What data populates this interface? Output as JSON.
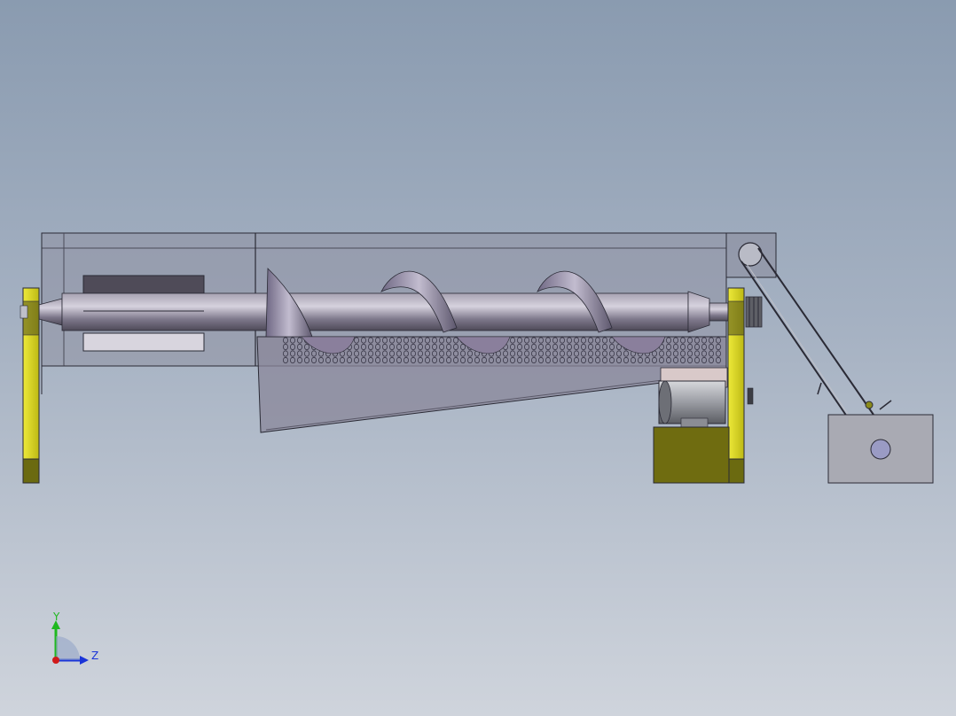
{
  "viewport": {
    "background_top": "#8a9bb0",
    "background_bottom": "#cfd4dc"
  },
  "model": {
    "description_visible": false,
    "colors": {
      "frame_yellow": "#d6d21f",
      "frame_yellow_dark": "#6b6a10",
      "motor_base": "#6f6c10",
      "housing_fill": "#8b8d9e",
      "shaft": "#75707f",
      "flight": "#8e85a3",
      "edge": "#2a2a35"
    }
  },
  "triad": {
    "y_label": "Y",
    "z_label": "Z",
    "y_color": "#1fb81f",
    "z_color": "#1a34d8",
    "x_color": "#d01a1a"
  }
}
